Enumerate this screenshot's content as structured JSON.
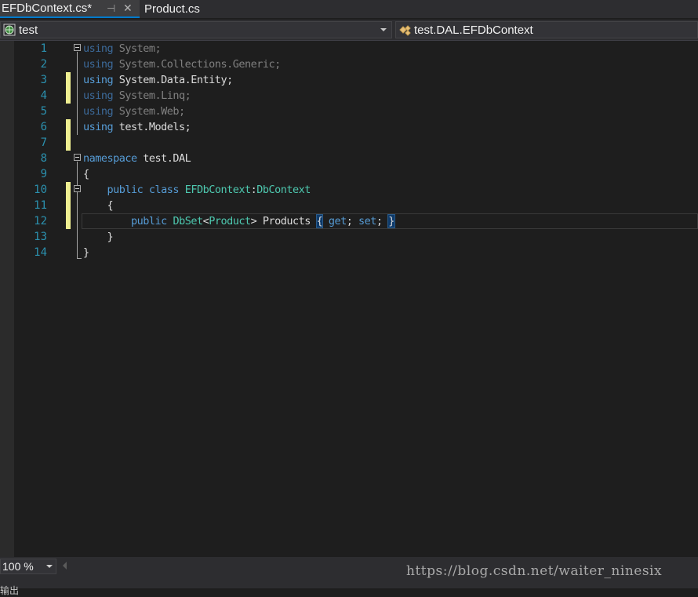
{
  "tabs": [
    {
      "label": "EFDbContext.cs*",
      "active": true
    },
    {
      "label": "Product.cs",
      "active": false
    }
  ],
  "tab_icons": {
    "pin": "pin-icon",
    "close": "close-icon"
  },
  "nav": {
    "project": "test",
    "member": "test.DAL.EFDbContext"
  },
  "line_numbers": [
    "1",
    "2",
    "3",
    "4",
    "5",
    "6",
    "7",
    "8",
    "9",
    "10",
    "11",
    "12",
    "13",
    "14"
  ],
  "code": {
    "l1": {
      "kw": "using",
      "rest": " System;"
    },
    "l2": {
      "kw": "using",
      "rest": " System.Collections.Generic;"
    },
    "l3": {
      "kw": "using",
      "rest": " System.Data.Entity;"
    },
    "l4": {
      "kw": "using",
      "rest": " System.Linq;"
    },
    "l5": {
      "kw": "using",
      "rest": " System.Web;"
    },
    "l6": {
      "kw": "using",
      "rest": " test.Models;"
    },
    "l8": {
      "kw": "namespace",
      "rest": " test.DAL"
    },
    "l9": "{",
    "l10": {
      "indent": "    ",
      "kw": "public class",
      "type": "EFDbContext",
      "colon": ":",
      "base": "DbContext"
    },
    "l11": "    {",
    "l12": {
      "indent": "        ",
      "kw": "public",
      "type": "DbSet",
      "lt": "<",
      "generic": "Product",
      "gt": ">",
      "name": " Products ",
      "open": "{",
      "get": "get",
      "semi1": ";",
      "set": "set",
      "semi2": ";",
      "close": "}"
    },
    "l13": "    }",
    "l14": "}"
  },
  "changed_lines": [
    3,
    4,
    6,
    7,
    10,
    11,
    12
  ],
  "zoom": "100 %",
  "watermark": "https://blog.csdn.net/waiter_ninesix",
  "bottom_partial": "输出",
  "colors": {
    "keyword": "#569cd6",
    "type": "#4ec9b0",
    "line_number": "#2b91af",
    "change_marker": "#efef91",
    "tab_accent": "#007acc"
  }
}
